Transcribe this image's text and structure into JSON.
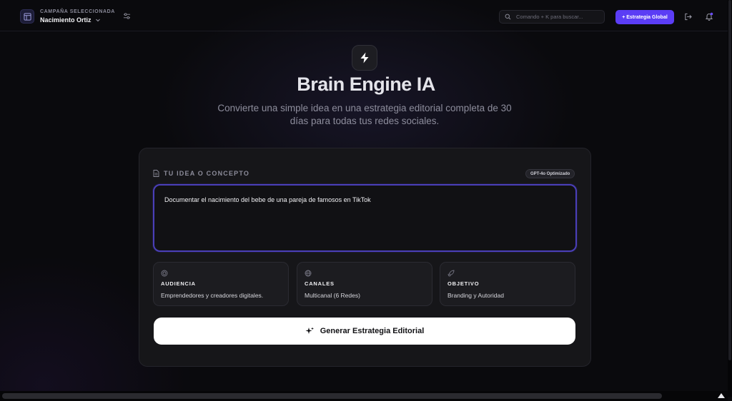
{
  "header": {
    "campaign_label": "CAMPAÑA SELECCIONADA",
    "campaign_name": "Nacimiento Ortiz",
    "search_placeholder": "Comando + K para buscar...",
    "new_strategy_label": "+ Estrategia Global"
  },
  "hero": {
    "title": "Brain Engine IA",
    "subtitle": "Convierte una simple idea en una estrategia editorial completa de 30 días para todas tus redes sociales."
  },
  "idea": {
    "section_label": "TU IDEA O CONCEPTO",
    "model_badge": "GPT-4o Optimizado",
    "value": "Documentar el nacimiento del bebe de una pareja de famosos en TikTok"
  },
  "options": [
    {
      "title": "AUDIENCIA",
      "value": "Emprendedores y creadores digitales.",
      "icon": "target-icon"
    },
    {
      "title": "CANALES",
      "value": "Multicanal (6 Redes)",
      "icon": "globe-icon"
    },
    {
      "title": "OBJETIVO",
      "value": "Branding y Autoridad",
      "icon": "rocket-icon"
    }
  ],
  "generate_label": "Generar Estrategia Editorial",
  "colors": {
    "accent": "#5b3df5",
    "field_border": "#4a3fb8",
    "background": "#0a0a0d"
  }
}
